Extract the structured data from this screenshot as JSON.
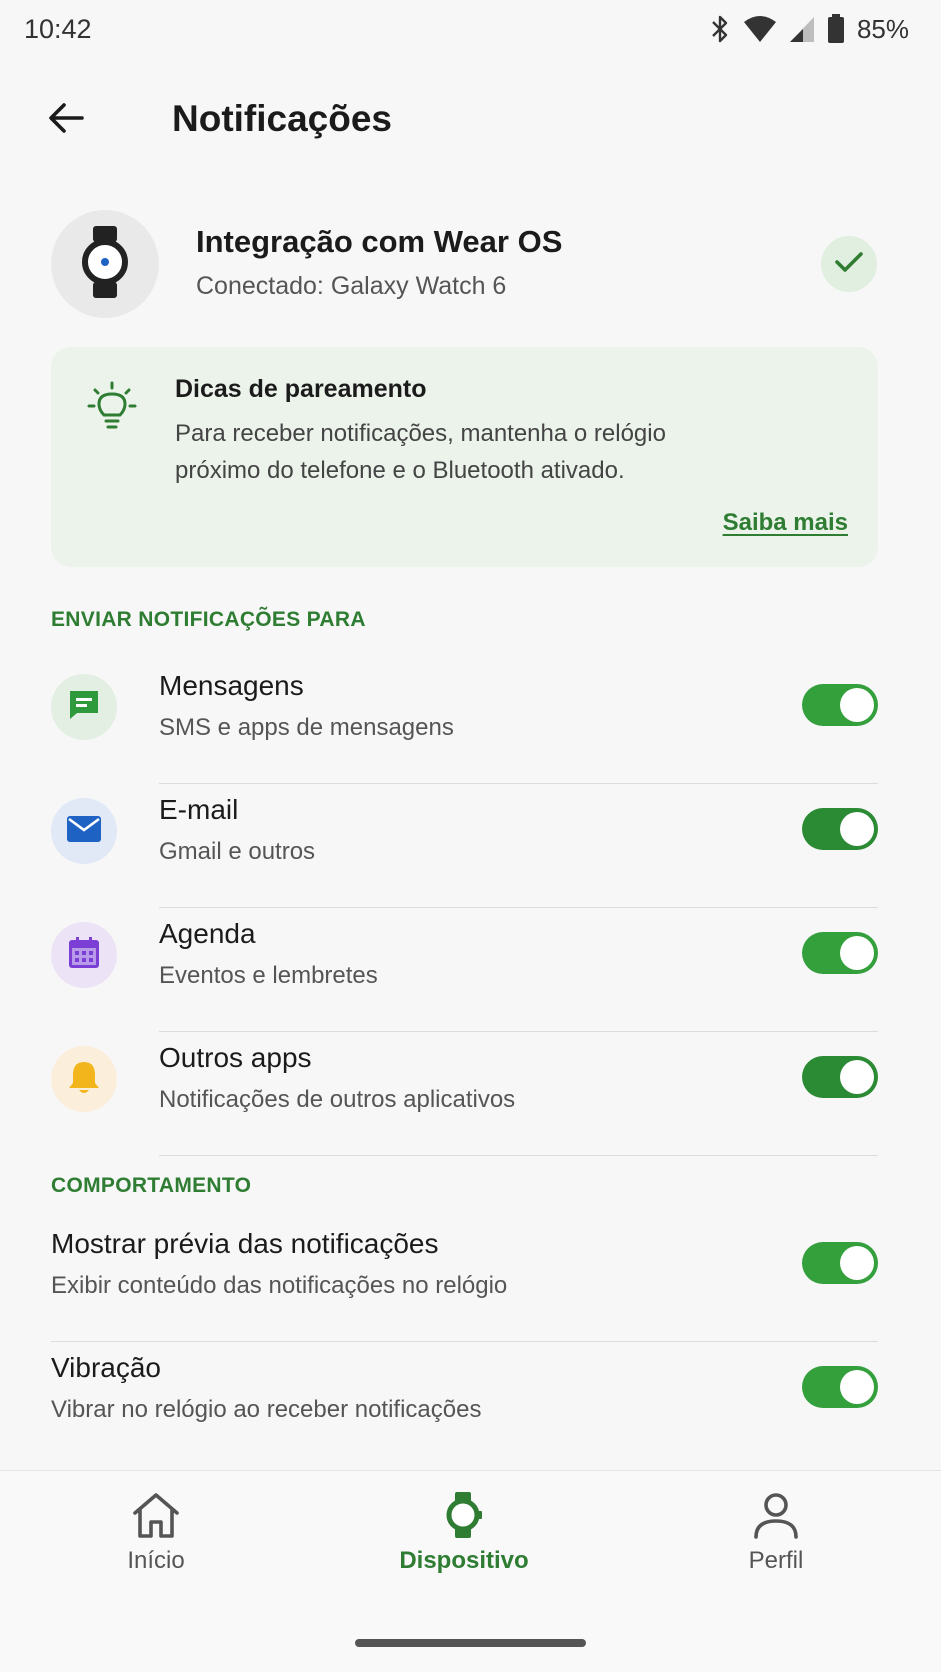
{
  "status_bar": {
    "time": "10:42",
    "battery": "85%",
    "icons": [
      "bluetooth-icon",
      "wifi-icon",
      "signal-icon",
      "battery-icon"
    ]
  },
  "app_bar": {
    "title": "Notificações",
    "back_icon": "arrow-left-icon"
  },
  "device": {
    "title": "Integração com Wear OS",
    "subtitle": "Conectado: Galaxy Watch 6",
    "icon": "watch-icon",
    "status_icon": "check-icon"
  },
  "tips": {
    "title": "Dicas de pareamento",
    "body": "Para receber notificações, mantenha o relógio próximo do telefone e o Bluetooth ativado.",
    "link": "Saiba mais",
    "icon": "lightbulb-icon"
  },
  "send_section": {
    "header": "ENVIAR NOTIFICAÇÕES PARA",
    "items": [
      {
        "title": "Mensagens",
        "subtitle": "SMS e apps de mensagens",
        "enabled": true,
        "icon": "message-icon",
        "icon_bg": "#e3efe3",
        "icon_color": "#2e9a3c"
      },
      {
        "title": "E-mail",
        "subtitle": "Gmail e outros",
        "enabled": true,
        "icon": "mail-icon",
        "icon_bg": "#e0e9f5",
        "icon_color": "#1e63c4"
      },
      {
        "title": "Agenda",
        "subtitle": "Eventos e lembretes",
        "enabled": true,
        "icon": "calendar-icon",
        "icon_bg": "#ece4f6",
        "icon_color": "#7b3fd6"
      },
      {
        "title": "Outros apps",
        "subtitle": "Notificações de outros aplicativos",
        "enabled": true,
        "icon": "bell-icon",
        "icon_bg": "#fbeedb",
        "icon_color": "#f3b51c"
      }
    ]
  },
  "behavior_section": {
    "header": "COMPORTAMENTO",
    "items": [
      {
        "title": "Mostrar prévia das notificações",
        "subtitle": "Exibir conteúdo das notificações no relógio",
        "enabled": true
      },
      {
        "title": "Vibração",
        "subtitle": "Vibrar no relógio ao receber notificações",
        "enabled": true
      }
    ]
  },
  "bottom_nav": {
    "items": [
      {
        "label": "Início",
        "icon": "home-icon",
        "active": false
      },
      {
        "label": "Dispositivo",
        "icon": "watch-icon",
        "active": true
      },
      {
        "label": "Perfil",
        "icon": "person-icon",
        "active": false
      }
    ]
  },
  "colors": {
    "accent": "#2e7d32",
    "toggle_on": "#34a03c",
    "tips_bg": "#ebf3eb"
  }
}
